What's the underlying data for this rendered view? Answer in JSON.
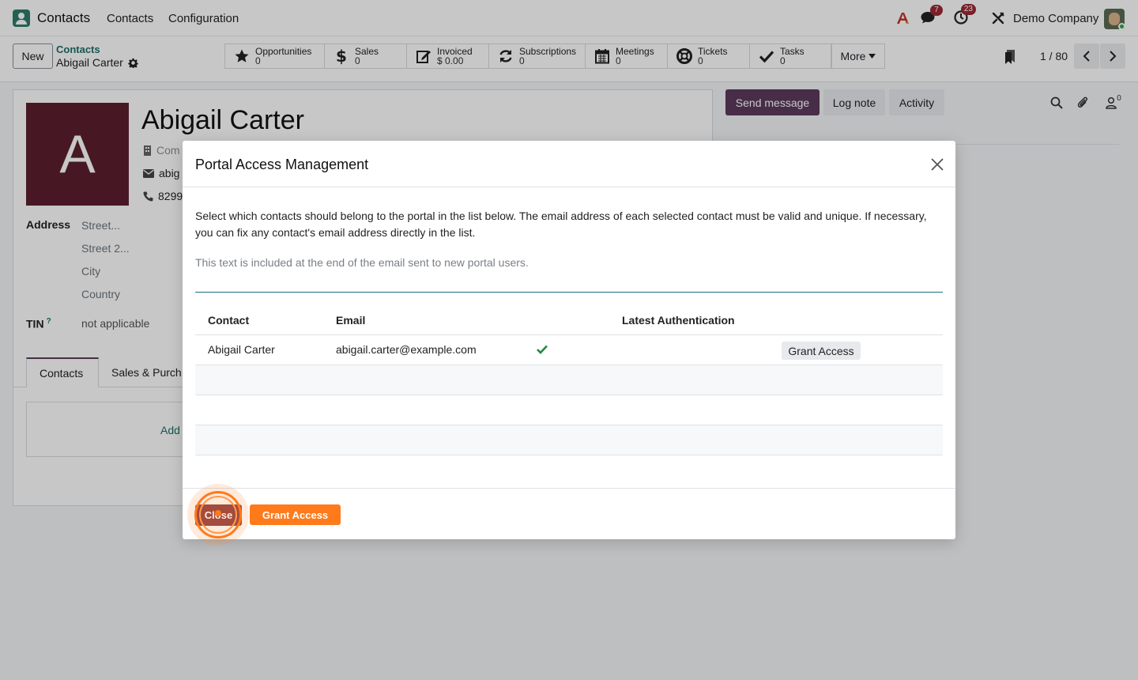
{
  "navbar": {
    "app_name": "Contacts",
    "menu": [
      "Contacts",
      "Configuration"
    ],
    "messages_badge": "7",
    "activities_badge": "23",
    "company": "Demo Company"
  },
  "control": {
    "new_label": "New",
    "breadcrumb_parent": "Contacts",
    "breadcrumb_current": "Abigail Carter",
    "smart_buttons": [
      {
        "label": "Opportunities",
        "value": "0",
        "icon": "star-icon"
      },
      {
        "label": "Sales",
        "value": "0",
        "icon": "dollar-icon"
      },
      {
        "label": "Invoiced",
        "value": "$ 0.00",
        "icon": "invoice-icon"
      },
      {
        "label": "Subscriptions",
        "value": "0",
        "icon": "refresh-icon"
      },
      {
        "label": "Meetings",
        "value": "0",
        "icon": "calendar-icon"
      },
      {
        "label": "Tickets",
        "value": "0",
        "icon": "lifebuoy-icon"
      },
      {
        "label": "Tasks",
        "value": "0",
        "icon": "check-icon"
      }
    ],
    "more_label": "More",
    "pager": "1 / 80"
  },
  "form": {
    "avatar_letter": "A",
    "name": "Abigail Carter",
    "company_placeholder": "Com",
    "email_partial": "abig",
    "phone_partial": "8299",
    "address_label": "Address",
    "street": "Street...",
    "street2": "Street 2...",
    "city": "City",
    "country": "Country",
    "tin_label": "TIN",
    "tin_help": "?",
    "tin_value": "not applicable",
    "tabs": [
      "Contacts",
      "Sales & Purch"
    ],
    "add_label": "Add"
  },
  "chatter": {
    "send_message": "Send message",
    "log_note": "Log note",
    "activity": "Activity",
    "followers_count": "0"
  },
  "modal": {
    "title": "Portal Access Management",
    "description": "Select which contacts should belong to the portal in the list below. The email address of each selected contact must be valid and unique. If necessary, you can fix any contact's email address directly in the list.",
    "note": "This text is included at the end of the email sent to new portal users.",
    "columns": [
      "Contact",
      "Email",
      "Latest Authentication"
    ],
    "rows": [
      {
        "contact": "Abigail Carter",
        "email": "abigail.carter@example.com",
        "latest_auth": "",
        "action": "Grant Access"
      }
    ],
    "close_label": "Close",
    "grant_label": "Grant Access"
  },
  "colors": {
    "brand": "#5c3a5c",
    "link": "#1d6f68",
    "avatar_bg": "#5c1f2e",
    "grant": "#ff7a1a",
    "close": "#8f3e3e",
    "badge": "#9c2a36"
  }
}
